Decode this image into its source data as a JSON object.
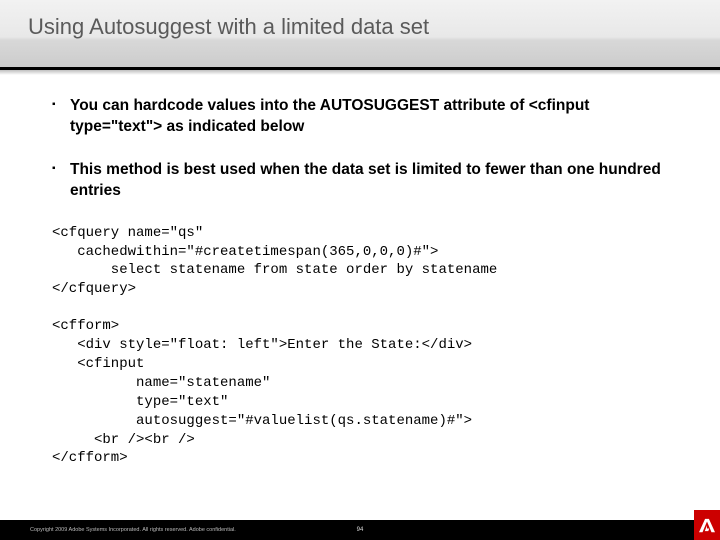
{
  "header": {
    "title": "Using Autosuggest with a limited data set"
  },
  "bullets": [
    "You can hardcode values into the AUTOSUGGEST attribute of <cfinput type=\"text\"> as indicated below",
    "This method is best used when the data set is limited to fewer than one hundred entries"
  ],
  "code_blocks": {
    "query": "<cfquery name=\"qs\"\n   cachedwithin=\"#createtimespan(365,0,0,0)#\">\n       select statename from state order by statename\n</cfquery>",
    "form": "<cfform>\n   <div style=\"float: left\">Enter the State:</div>\n   <cfinput\n          name=\"statename\"\n          type=\"text\"\n          autosuggest=\"#valuelist(qs.statename)#\">\n     <br /><br />\n</cfform>"
  },
  "footer": {
    "copyright": "Copyright 2009 Adobe Systems Incorporated.  All rights reserved.  Adobe confidential.",
    "page_number": "94"
  }
}
